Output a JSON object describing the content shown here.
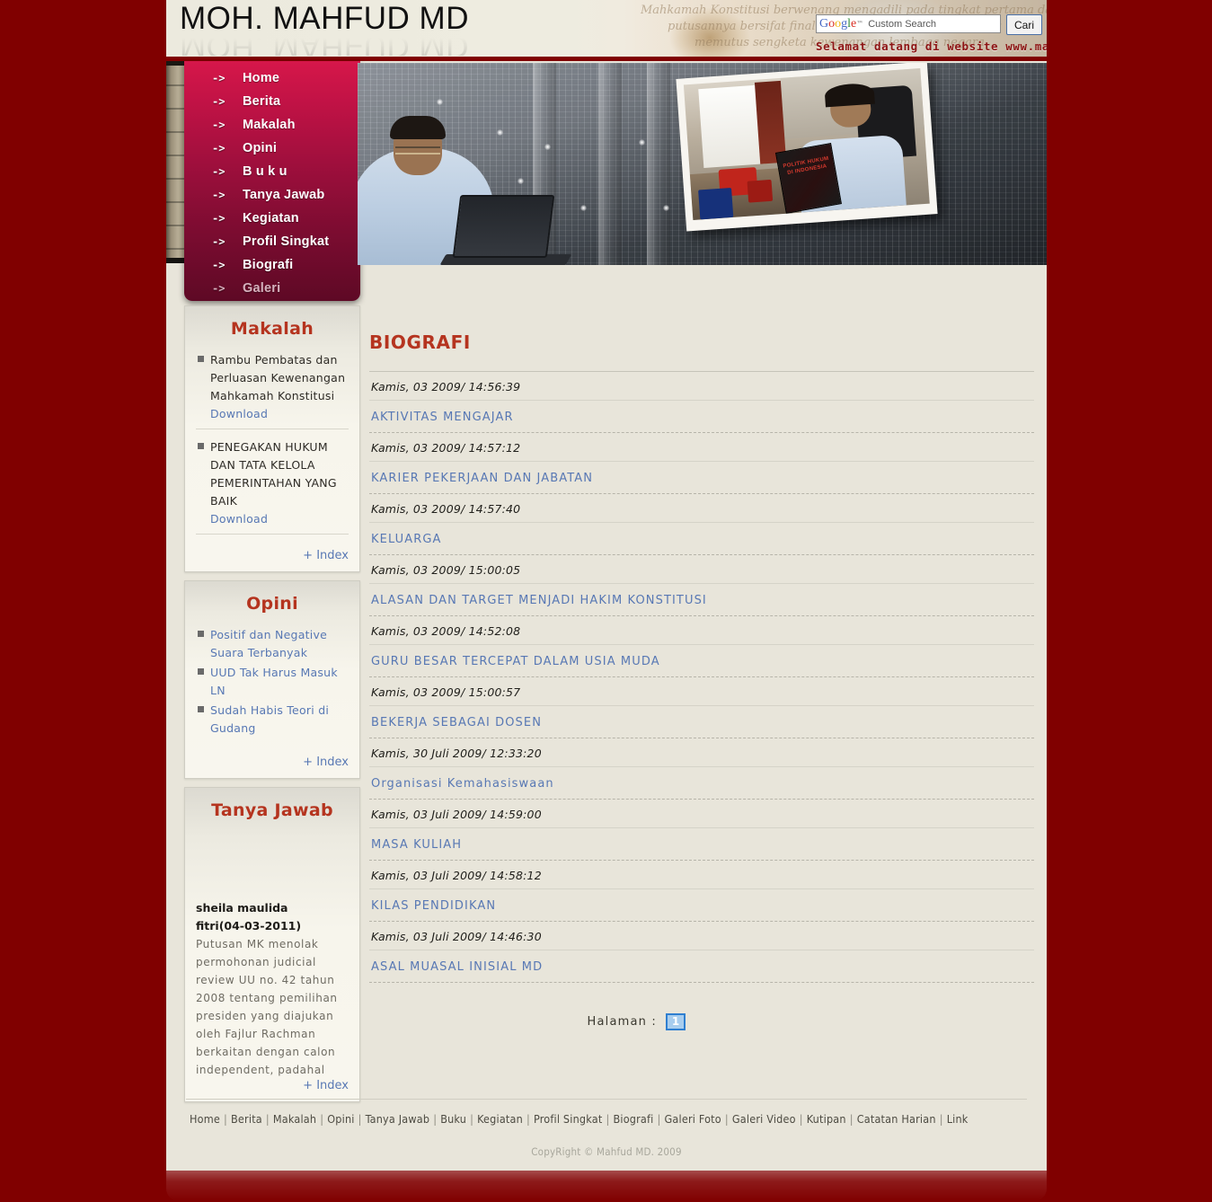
{
  "header": {
    "site_title": "MOH. MAHFUD MD",
    "art_script_lines": [
      "Mahkamah Konstitusi berwenang mengadili pada tingkat pertama dan terakhir",
      "putusannya bersifat final untuk menguji undang-undang",
      "memutus sengketa kewenangan lembaga negara"
    ],
    "welcome_text": "Selamat datang di website www.mahfu"
  },
  "search": {
    "brand_letters": [
      "G",
      "o",
      "o",
      "g",
      "l",
      "e"
    ],
    "brand_tm": "™",
    "placeholder": "Custom Search",
    "value": "",
    "button_label": "Cari"
  },
  "nav": {
    "arrow_glyph": "->",
    "items": [
      {
        "label": "Home"
      },
      {
        "label": "Berita"
      },
      {
        "label": "Makalah"
      },
      {
        "label": "Opini"
      },
      {
        "label": "B u k u"
      },
      {
        "label": "Tanya Jawab"
      },
      {
        "label": "Kegiatan"
      },
      {
        "label": "Profil Singkat"
      },
      {
        "label": "Biografi"
      },
      {
        "label": "Galeri"
      }
    ]
  },
  "banner": {
    "photo_book_title": "POLITIK HUKUM DI INDONESIA"
  },
  "sidebar": {
    "makalah": {
      "title": "Makalah",
      "items": [
        {
          "title": "Rambu Pembatas dan Perluasan Kewenangan Mahkamah Konstitusi",
          "download_label": "Download"
        },
        {
          "title": "PENEGAKAN HUKUM DAN TATA KELOLA PEMERINTAHAN YANG BAIK",
          "download_label": "Download"
        }
      ],
      "index_label": "+ Index"
    },
    "opini": {
      "title": "Opini",
      "items": [
        {
          "title": "Positif dan Negative Suara Terbanyak"
        },
        {
          "title": "UUD Tak Harus Masuk LN"
        },
        {
          "title": "Sudah Habis Teori di Gudang"
        }
      ],
      "index_label": "+ Index"
    },
    "tanya_jawab": {
      "title": "Tanya Jawab",
      "author": "sheila maulida",
      "author_date": "fitri(04-03-2011)",
      "excerpt": "Putusan MK menolak permohonan judicial review UU no. 42 tahun 2008 tentang pemilihan presiden yang diajukan oleh Fajlur Rachman berkaitan dengan calon independent, padahal",
      "index_label": "+ Index"
    }
  },
  "main": {
    "title": "BIOGRAFI",
    "entries": [
      {
        "date": "Kamis, 03 2009/ 14:56:39",
        "title": "AKTIVITAS MENGAJAR"
      },
      {
        "date": "Kamis, 03 2009/ 14:57:12",
        "title": "KARIER PEKERJAAN DAN JABATAN"
      },
      {
        "date": "Kamis, 03 2009/ 14:57:40",
        "title": "KELUARGA"
      },
      {
        "date": "Kamis, 03 2009/ 15:00:05",
        "title": "ALASAN DAN TARGET MENJADI HAKIM KONSTITUSI"
      },
      {
        "date": "Kamis, 03 2009/ 14:52:08",
        "title": "GURU BESAR TERCEPAT DALAM USIA MUDA"
      },
      {
        "date": "Kamis, 03 2009/ 15:00:57",
        "title": "BEKERJA SEBAGAI DOSEN"
      },
      {
        "date": "Kamis, 30 Juli 2009/ 12:33:20",
        "title": "Organisasi Kemahasiswaan"
      },
      {
        "date": "Kamis, 03 Juli 2009/ 14:59:00",
        "title": "MASA KULIAH"
      },
      {
        "date": "Kamis, 03 Juli 2009/ 14:58:12",
        "title": "KILAS PENDIDIKAN"
      },
      {
        "date": "Kamis, 03 Juli 2009/ 14:46:30",
        "title": "ASAL MUASAL INISIAL MD"
      }
    ],
    "pager": {
      "label": "Halaman :",
      "current": "1"
    }
  },
  "footer": {
    "links": [
      "Home",
      "Berita",
      "Makalah",
      "Opini",
      "Tanya Jawab",
      "Buku",
      "Kegiatan",
      "Profil Singkat",
      "Biografi",
      "Galeri Foto",
      "Galeri Video",
      "Kutipan",
      "Catatan Harian",
      "Link"
    ],
    "separator": "|",
    "copyright": "CopyRight © Mahfud MD. 2009"
  },
  "colors": {
    "page_background": "#800000",
    "content_background": "#e8e5da",
    "accent_red": "#b5341f",
    "link_blue": "#5878b4",
    "nav_gradient_top": "#d6174a",
    "nav_gradient_bottom": "#5e0925",
    "pager_border": "#2f7fd0",
    "pager_fill": "#a8cdee"
  }
}
